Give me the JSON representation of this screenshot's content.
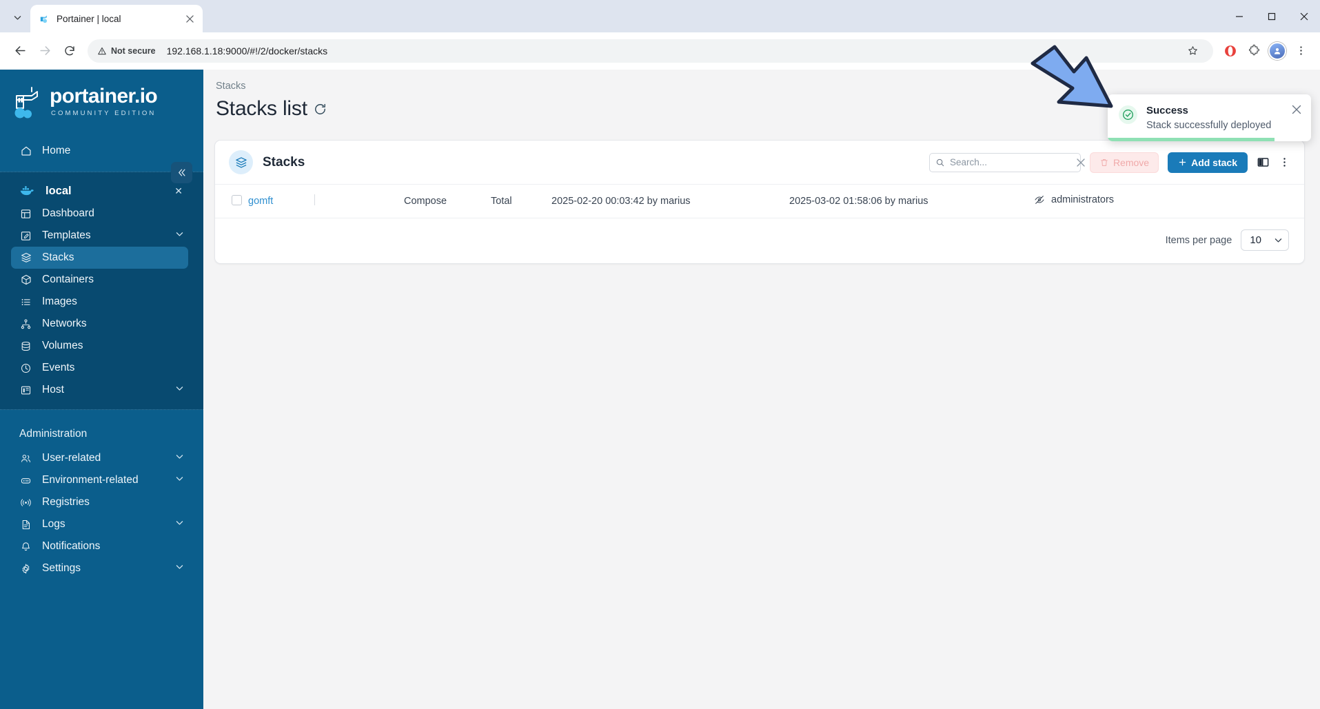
{
  "browser": {
    "tab": {
      "title": "Portainer | local",
      "favicon_icon": "portainer-favicon",
      "close_icon": "close-icon"
    },
    "tab_list_icon": "chevron-down-icon",
    "back_icon": "back-arrow-icon",
    "forward_icon": "forward-arrow-icon",
    "reload_icon": "reload-icon",
    "security_label": "Not secure",
    "security_icon": "warning-triangle-icon",
    "url": "192.168.1.18:9000/#!/2/docker/stacks",
    "bookmark_icon": "star-icon",
    "opera_icon": "opera-extension-icon",
    "extensions_icon": "puzzle-piece-icon",
    "profile_icon": "avatar-icon",
    "menu_icon": "kebab-menu-icon",
    "window": {
      "minimize": "minimize-icon",
      "maximize": "maximize-icon",
      "close": "close-icon"
    }
  },
  "sidebar": {
    "logo": {
      "word": "portainer.io",
      "subtitle": "COMMUNITY EDITION",
      "icon": "portainer-crane-logo"
    },
    "collapse_icon": "double-chevron-left-icon",
    "home": {
      "label": "Home",
      "icon": "home-icon"
    },
    "environment": {
      "label": "local",
      "icon": "docker-whale-icon",
      "close_icon": "close-icon"
    },
    "env_items": [
      {
        "label": "Dashboard",
        "icon": "dashboard-icon",
        "expandable": false,
        "active": false
      },
      {
        "label": "Templates",
        "icon": "template-edit-icon",
        "expandable": true,
        "active": false
      },
      {
        "label": "Stacks",
        "icon": "layers-icon",
        "expandable": false,
        "active": true
      },
      {
        "label": "Containers",
        "icon": "container-box-icon",
        "expandable": false,
        "active": false
      },
      {
        "label": "Images",
        "icon": "list-icon",
        "expandable": false,
        "active": false
      },
      {
        "label": "Networks",
        "icon": "network-nodes-icon",
        "expandable": false,
        "active": false
      },
      {
        "label": "Volumes",
        "icon": "database-icon",
        "expandable": false,
        "active": false
      },
      {
        "label": "Events",
        "icon": "clock-icon",
        "expandable": false,
        "active": false
      },
      {
        "label": "Host",
        "icon": "server-icon",
        "expandable": true,
        "active": false
      }
    ],
    "admin_label": "Administration",
    "admin_items": [
      {
        "label": "User-related",
        "icon": "users-icon",
        "expandable": true
      },
      {
        "label": "Environment-related",
        "icon": "environment-icon",
        "expandable": true
      },
      {
        "label": "Registries",
        "icon": "broadcast-icon",
        "expandable": false
      },
      {
        "label": "Logs",
        "icon": "document-icon",
        "expandable": true
      },
      {
        "label": "Notifications",
        "icon": "bell-icon",
        "expandable": false
      },
      {
        "label": "Settings",
        "icon": "gear-icon",
        "expandable": true
      }
    ]
  },
  "main": {
    "breadcrumb": "Stacks",
    "page_title": "Stacks list",
    "refresh_icon": "refresh-icon",
    "card": {
      "title": "Stacks",
      "icon": "layers-icon",
      "search": {
        "placeholder": "Search...",
        "value": "",
        "icon": "search-icon",
        "clear_icon": "close-icon"
      },
      "remove_button": {
        "label": "Remove",
        "icon": "trash-icon",
        "disabled": true
      },
      "add_button": {
        "label": "Add stack",
        "icon": "plus-icon"
      },
      "columns_icon": "column-layout-icon",
      "more_icon": "kebab-menu-icon"
    },
    "table": {
      "rows": [
        {
          "name": "gomft",
          "type": "Compose",
          "control": "Total",
          "created": "2025-02-20 00:03:42 by marius",
          "updated": "2025-03-02 01:58:06 by marius",
          "ownership": "administrators",
          "ownership_icon": "eye-off-icon",
          "checkbox_icon": "checkbox-unchecked"
        }
      ]
    },
    "footer": {
      "items_per_page_label": "Items per page",
      "items_per_page_value": "10",
      "dropdown_icon": "chevron-down-icon"
    }
  },
  "toast": {
    "title": "Success",
    "message": "Stack successfully deployed",
    "icon": "check-circle-icon",
    "close_icon": "close-icon",
    "accent_color": "#23a05f",
    "progress_color": "#8fe0b4"
  },
  "annotation": {
    "arrow_icon": "blue-arrow-pointer",
    "color": "#7eabf0"
  }
}
